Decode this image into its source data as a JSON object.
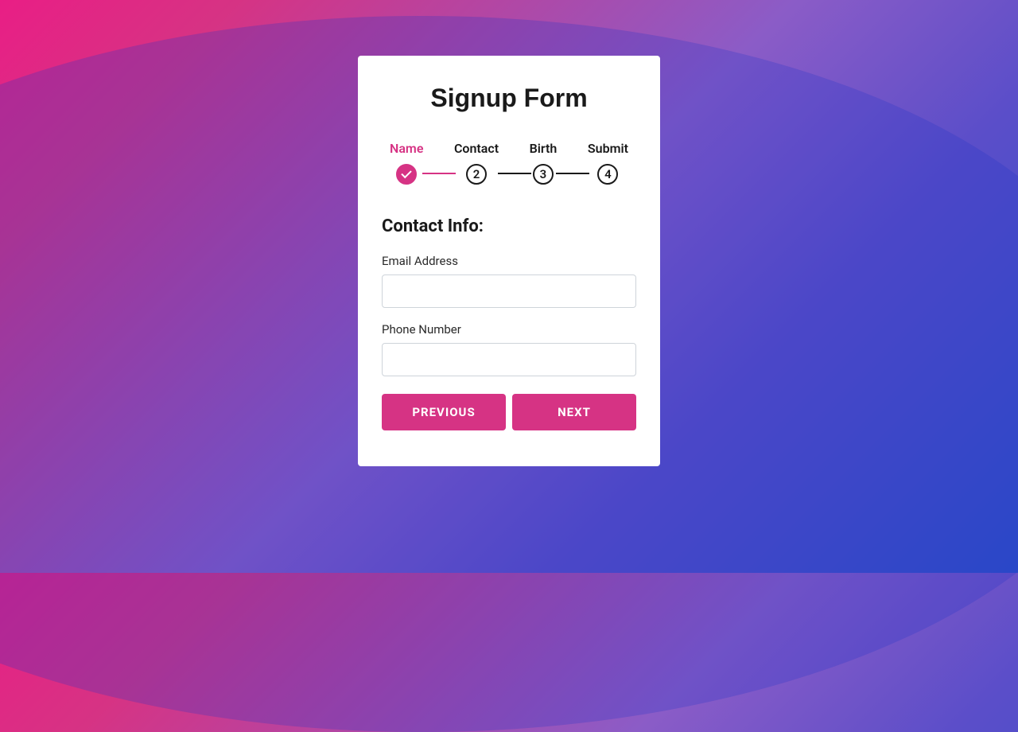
{
  "title": "Signup Form",
  "steps": [
    {
      "label": "Name",
      "number": "1",
      "completed": true,
      "active": true
    },
    {
      "label": "Contact",
      "number": "2",
      "completed": false,
      "active": false
    },
    {
      "label": "Birth",
      "number": "3",
      "completed": false,
      "active": false
    },
    {
      "label": "Submit",
      "number": "4",
      "completed": false,
      "active": false
    }
  ],
  "section": {
    "title": "Contact Info:",
    "fields": [
      {
        "label": "Email Address",
        "value": ""
      },
      {
        "label": "Phone Number",
        "value": ""
      }
    ]
  },
  "buttons": {
    "previous": "PREVIOUS",
    "next": "NEXT"
  },
  "colors": {
    "accent": "#d63384",
    "text": "#1a1a1a",
    "border": "#ced4da"
  }
}
